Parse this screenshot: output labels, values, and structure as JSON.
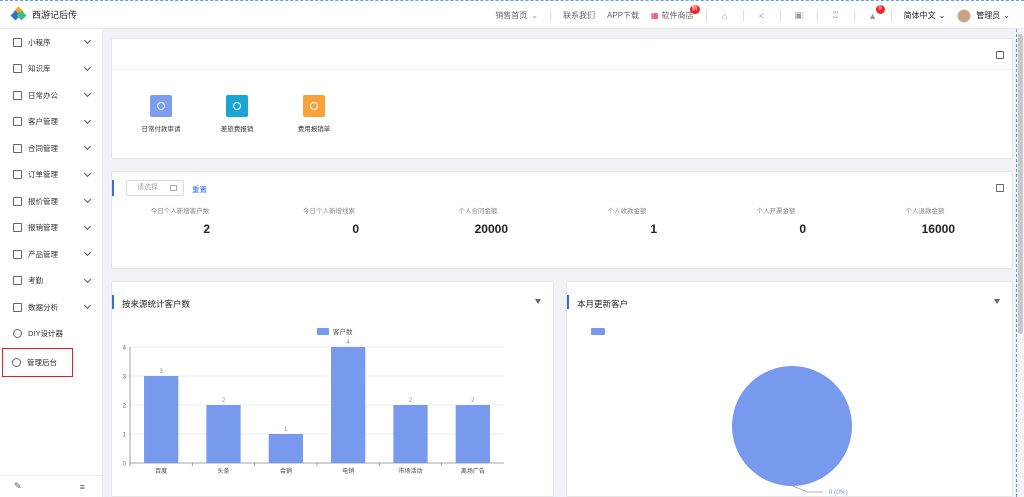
{
  "app": {
    "title": "西游记后传",
    "accent": "#2f6fd8"
  },
  "topnav": {
    "sales_home": "销售首页",
    "contact": "联系我们",
    "app_download": "APP下载",
    "software_store": "软件商店",
    "store_badge": "新",
    "notify_badge": "9",
    "language": "简体中文",
    "user": "管理员"
  },
  "sidebar": {
    "items": [
      {
        "label": "小程序",
        "icon": "grid-icon"
      },
      {
        "label": "知识库",
        "icon": "book-icon"
      },
      {
        "label": "日常办公",
        "icon": "briefcase-icon"
      },
      {
        "label": "客户管理",
        "icon": "customer-icon"
      },
      {
        "label": "合同管理",
        "icon": "contract-icon"
      },
      {
        "label": "订单管理",
        "icon": "order-icon"
      },
      {
        "label": "报价管理",
        "icon": "quote-icon"
      },
      {
        "label": "报销管理",
        "icon": "reimburse-icon"
      },
      {
        "label": "产品管理",
        "icon": "product-icon"
      },
      {
        "label": "考勤",
        "icon": "attendance-icon"
      },
      {
        "label": "数据分析",
        "icon": "chart-icon"
      },
      {
        "label": "DIY设计器",
        "icon": "tools-icon"
      },
      {
        "label": "管理后台",
        "icon": "settings-icon"
      }
    ]
  },
  "quick_apps": [
    {
      "label": "日常付款审请",
      "color": "#7b9ef2"
    },
    {
      "label": "差旅费报销",
      "color": "#1aa3d6"
    },
    {
      "label": "费用报销单",
      "color": "#f7a23b"
    }
  ],
  "filter": {
    "placeholder": "请选择",
    "reset": "重置"
  },
  "stats": [
    {
      "label": "今日个人新增客户数",
      "value": "2"
    },
    {
      "label": "今日个人新增线索",
      "value": "0"
    },
    {
      "label": "个人合同金额",
      "value": "20000"
    },
    {
      "label": "个人收款金额",
      "value": "1"
    },
    {
      "label": "个人开票金额",
      "value": "0"
    },
    {
      "label": "个人退款金额",
      "value": "16000"
    }
  ],
  "customer_panel": {
    "title": "按来源统计客户数"
  },
  "monthly_panel": {
    "title": "本月更新客户"
  },
  "chart_data": [
    {
      "type": "bar",
      "legend": [
        "客户数"
      ],
      "categories": [
        "百度",
        "头条",
        "会销",
        "电销",
        "市场活动",
        "离场广告"
      ],
      "series": [
        {
          "name": "客户数",
          "values": [
            3,
            2,
            1,
            4,
            2,
            2
          ]
        }
      ],
      "ylim": [
        0,
        4
      ],
      "yticks": [
        0,
        1,
        2,
        3,
        4
      ],
      "color": "#7799ee",
      "grid": true
    },
    {
      "type": "pie",
      "slices": [
        {
          "name": "",
          "value": 0,
          "label": ": 0 (0%)"
        }
      ],
      "color": "#7799ee"
    }
  ]
}
